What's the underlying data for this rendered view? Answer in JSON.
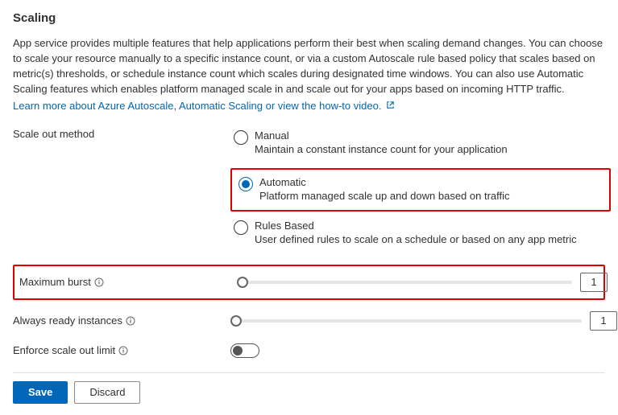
{
  "header": {
    "title": "Scaling"
  },
  "intro": {
    "text": "App service provides multiple features that help applications perform their best when scaling demand changes. You can choose to scale your resource manually to a specific instance count, or via a custom Autoscale rule based policy that scales based on metric(s) thresholds, or schedule instance count which scales during designated time windows. You can also use Automatic Scaling features which enables platform managed scale in and scale out for your apps based on incoming HTTP traffic.",
    "link_text": "Learn more about Azure Autoscale, Automatic Scaling or view the how-to video."
  },
  "scale_out": {
    "label": "Scale out method",
    "options": [
      {
        "title": "Manual",
        "desc": "Maintain a constant instance count for your application",
        "selected": false
      },
      {
        "title": "Automatic",
        "desc": "Platform managed scale up and down based on traffic",
        "selected": true
      },
      {
        "title": "Rules Based",
        "desc": "User defined rules to scale on a schedule or based on any app metric",
        "selected": false
      }
    ]
  },
  "max_burst": {
    "label": "Maximum burst",
    "value": "1"
  },
  "always_ready": {
    "label": "Always ready instances",
    "value": "1"
  },
  "enforce_limit": {
    "label": "Enforce scale out limit",
    "on": false
  },
  "footer": {
    "save": "Save",
    "discard": "Discard"
  }
}
